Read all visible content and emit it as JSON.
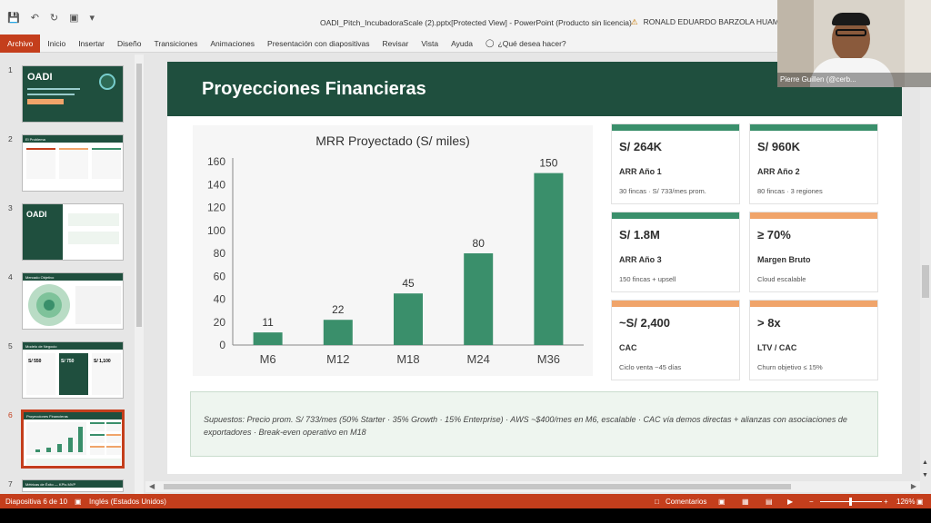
{
  "titlebar": {
    "document_title": "OADI_Pitch_IncubadoraScale (2).pptx[Protected View] - PowerPoint (Producto sin licencia)",
    "user": "RONALD EDUARDO BARZOLA HUAMAN"
  },
  "ribbon": {
    "tabs": [
      "Archivo",
      "Inicio",
      "Insertar",
      "Diseño",
      "Transiciones",
      "Animaciones",
      "Presentación con diapositivas",
      "Revisar",
      "Vista",
      "Ayuda"
    ],
    "tell_me": "¿Qué desea hacer?"
  },
  "thumbnails": {
    "numbers": [
      "1",
      "2",
      "3",
      "4",
      "5",
      "6",
      "7"
    ],
    "t1_title": "OADI",
    "t2_title": "El Problema",
    "t3_title": "OADI",
    "t4_title": "Mercado Objetivo",
    "t5_title": "Modelo de Negocio",
    "t5_prices": [
      "S/ 550",
      "S/ 750",
      "S/ 1,100"
    ],
    "t6_title": "Proyecciones Financieras",
    "t7_title": "Métricas de Éxito — KPIs MVP"
  },
  "slide": {
    "title": "Proyecciones Financieras",
    "cards": [
      {
        "value": "S/ 264K",
        "label": "ARR Año 1",
        "sub": "30 fincas · S/ 733/mes prom.",
        "color": "#3a8f6b"
      },
      {
        "value": "S/ 960K",
        "label": "ARR Año 2",
        "sub": "80 fincas · 3 regiones",
        "color": "#3a8f6b"
      },
      {
        "value": "S/ 1.8M",
        "label": "ARR Año 3",
        "sub": "150 fincas + upsell",
        "color": "#3a8f6b"
      },
      {
        "value": "≥ 70%",
        "label": "Margen Bruto",
        "sub": "Cloud escalable",
        "color": "#f0a46a"
      },
      {
        "value": "~S/ 2,400",
        "label": "CAC",
        "sub": "Ciclo venta ~45 días",
        "color": "#f0a46a"
      },
      {
        "value": "> 8x",
        "label": "LTV / CAC",
        "sub": "Churn objetivo ≤ 15%",
        "color": "#f0a46a"
      }
    ],
    "notes": "Supuestos: Precio prom. S/ 733/mes (50% Starter · 35% Growth · 15% Enterprise) · AWS ~$400/mes en M6, escalable · CAC vía demos directas + alianzas con asociaciones de exportadores · Break-even operativo en M18"
  },
  "chart_data": {
    "type": "bar",
    "title": "MRR Proyectado (S/ miles)",
    "categories": [
      "M6",
      "M12",
      "M18",
      "M24",
      "M36"
    ],
    "values": [
      11,
      22,
      45,
      80,
      150
    ],
    "yticks": [
      0,
      20,
      40,
      60,
      80,
      100,
      120,
      140,
      160
    ],
    "ylim": [
      0,
      160
    ],
    "grid": false,
    "color": "#3a8f6b"
  },
  "status": {
    "slide": "Diapositiva 6 de 10",
    "language": "Inglés (Estados Unidos)",
    "comments": "Comentarios",
    "zoom": "126%"
  },
  "video": {
    "name": "Pierre Guillen (@cerb..."
  },
  "colors": {
    "accent": "#c43e1c",
    "slide_green": "#1f4f3e"
  }
}
